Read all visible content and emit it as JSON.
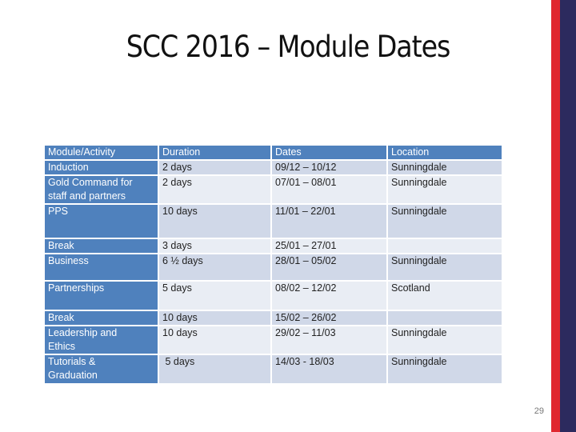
{
  "slide": {
    "title": "SCC 2016 – Module Dates",
    "page_number": "29",
    "colors": {
      "header_blue": "#4f81bd",
      "row_dark": "#d0d8e8",
      "row_light": "#e9edf4",
      "stripe_red": "#e0272f",
      "stripe_navy": "#2c2a5e"
    }
  },
  "table": {
    "headers": [
      "Module/Activity",
      "Duration",
      "Dates",
      "Location"
    ],
    "rows": [
      {
        "module": "Induction",
        "module2": "",
        "duration": "2 days",
        "duration2": "",
        "dates": "09/12 – 10/12",
        "dates2": "",
        "location": "Sunningdale",
        "location2": ""
      },
      {
        "module": "Gold Command for",
        "module2": "staff and partners",
        "duration": "2 days",
        "duration2": "",
        "dates": "07/01 – 08/01",
        "dates2": "",
        "location": "Sunningdale",
        "location2": ""
      },
      {
        "module": "PPS",
        "module2": "",
        "duration": "10 days",
        "duration2": "",
        "dates": "11/01 – 22/01",
        "dates2": "",
        "location": "Sunningdale",
        "location2": ""
      },
      {
        "module": "Break",
        "module2": "",
        "duration": "3 days",
        "duration2": "",
        "dates": "25/01 – 27/01",
        "dates2": "",
        "location": "",
        "location2": ""
      },
      {
        "module": "Business",
        "module2": "",
        "duration": "6 ½ days",
        "duration2": "",
        "dates": "28/01 – 05/02",
        "dates2": "",
        "location": "Sunningdale",
        "location2": ""
      },
      {
        "module": "Partnerships",
        "module2": "",
        "duration": "5 days",
        "duration2": "",
        "dates": "08/02 – 12/02",
        "dates2": "",
        "location": "Scotland",
        "location2": ""
      },
      {
        "module": "Break",
        "module2": "",
        "duration": "10 days",
        "duration2": "",
        "dates": "15/02 – 26/02",
        "dates2": "",
        "location": "",
        "location2": ""
      },
      {
        "module": "Leadership and",
        "module2": "Ethics",
        "duration": "10 days",
        "duration2": "",
        "dates": "29/02 – 11/03",
        "dates2": "",
        "location": "Sunningdale",
        "location2": ""
      },
      {
        "module": "Tutorials &",
        "module2": "Graduation",
        "duration": " 5 days",
        "duration2": "",
        "dates": "14/03 - 18/03",
        "dates2": "",
        "location": "Sunningdale",
        "location2": ""
      }
    ]
  }
}
